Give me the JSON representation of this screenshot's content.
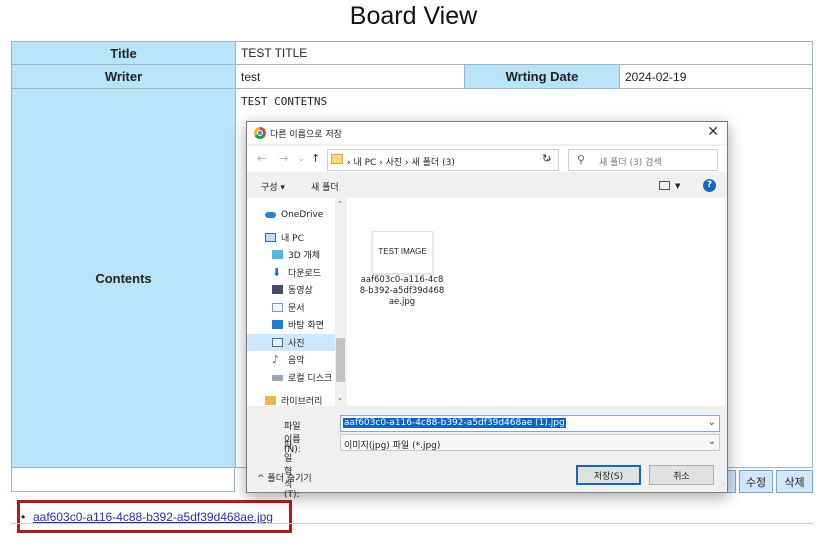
{
  "page": {
    "title": "Board View"
  },
  "board": {
    "title_label": "Title",
    "title_value": "TEST TITLE",
    "writer_label": "Writer",
    "writer_value": "test",
    "date_label": "Wrting Date",
    "date_value": "2024-02-19",
    "contents_label": "Contents",
    "contents_value": "TEST CONTETNS"
  },
  "buttons": {
    "edit": "수정",
    "delete": "삭제"
  },
  "attachment": {
    "filename": "aaf603c0-a116-4c88-b392-a5df39d468ae.jpg"
  },
  "dialog": {
    "title": "다른 이름으로 저장",
    "path_segments": "› 내 PC › 사진 › 새 폴더 (3)",
    "search_placeholder": "새 폴더 (3) 검색",
    "organize": "구성 ▾",
    "new_folder": "새 폴더",
    "nav_items": [
      {
        "label": "OneDrive",
        "icon": "cloud-icon"
      },
      {
        "label": "내 PC",
        "icon": "pc-icon"
      },
      {
        "label": "3D 개체",
        "icon": "cube-icon"
      },
      {
        "label": "다운로드",
        "icon": "download-icon"
      },
      {
        "label": "동영상",
        "icon": "video-icon"
      },
      {
        "label": "문서",
        "icon": "document-icon"
      },
      {
        "label": "바탕 화면",
        "icon": "desktop-icon"
      },
      {
        "label": "사진",
        "icon": "pictures-icon"
      },
      {
        "label": "음악",
        "icon": "music-icon"
      },
      {
        "label": "로컬 디스크",
        "icon": "disk-icon"
      },
      {
        "label": "라이브러리",
        "icon": "library-icon"
      }
    ],
    "thumbnail_text": "TEST IMAGE",
    "file_item_name": "aaf603c0-a116-4c88-b392-a5df39d468ae.jpg",
    "filename_label": "파일 이름(N):",
    "filename_value": "aaf603c0-a116-4c88-b392-a5df39d468ae (1).jpg",
    "filetype_label": "파일 형식(T):",
    "filetype_value": "이미지(jpg) 파일 (*.jpg)",
    "hide_folders": "폴더 숨기기",
    "save_button": "저장(S)",
    "cancel_button": "취소"
  }
}
